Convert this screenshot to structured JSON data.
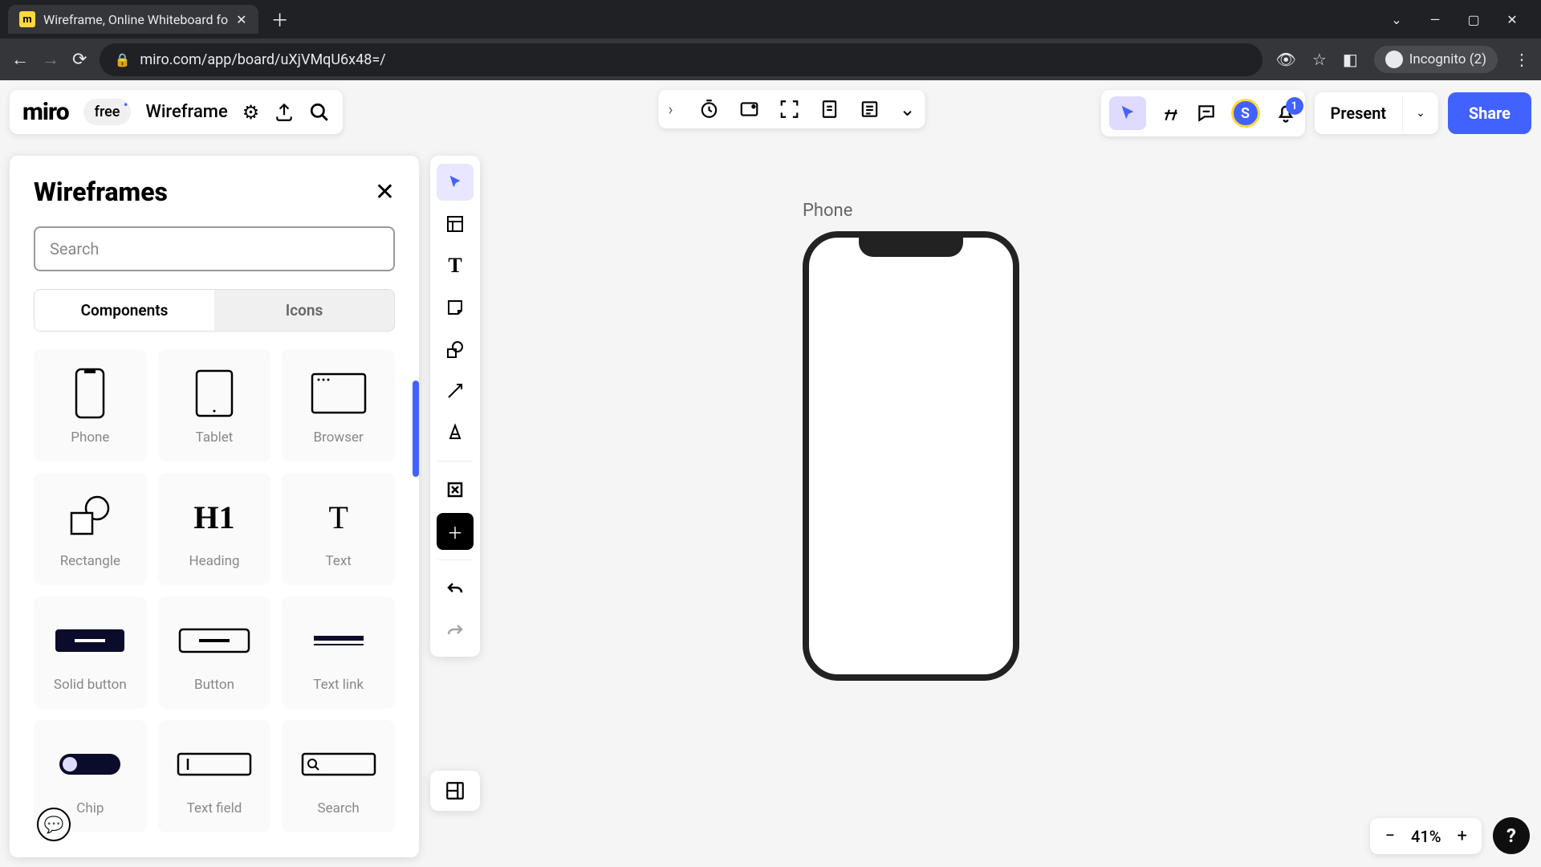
{
  "browser": {
    "tab_title": "Wireframe, Online Whiteboard fo",
    "favicon_letter": "m",
    "url": "miro.com/app/board/uXjVMqU6x48=/",
    "incognito_label": "Incognito (2)"
  },
  "header": {
    "logo": "miro",
    "plan": "free",
    "board_name": "Wireframe"
  },
  "top_right": {
    "avatar_initial": "S",
    "notif_count": "1",
    "present": "Present",
    "share": "Share"
  },
  "panel": {
    "title": "Wireframes",
    "search_placeholder": "Search",
    "tab_components": "Components",
    "tab_icons": "Icons",
    "components": [
      {
        "label": "Phone"
      },
      {
        "label": "Tablet"
      },
      {
        "label": "Browser"
      },
      {
        "label": "Rectangle"
      },
      {
        "label": "Heading"
      },
      {
        "label": "Text"
      },
      {
        "label": "Solid button"
      },
      {
        "label": "Button"
      },
      {
        "label": "Text link"
      },
      {
        "label": "Chip"
      },
      {
        "label": "Text field"
      },
      {
        "label": "Search"
      }
    ]
  },
  "canvas": {
    "phone_label": "Phone"
  },
  "zoom": {
    "level": "41%"
  }
}
